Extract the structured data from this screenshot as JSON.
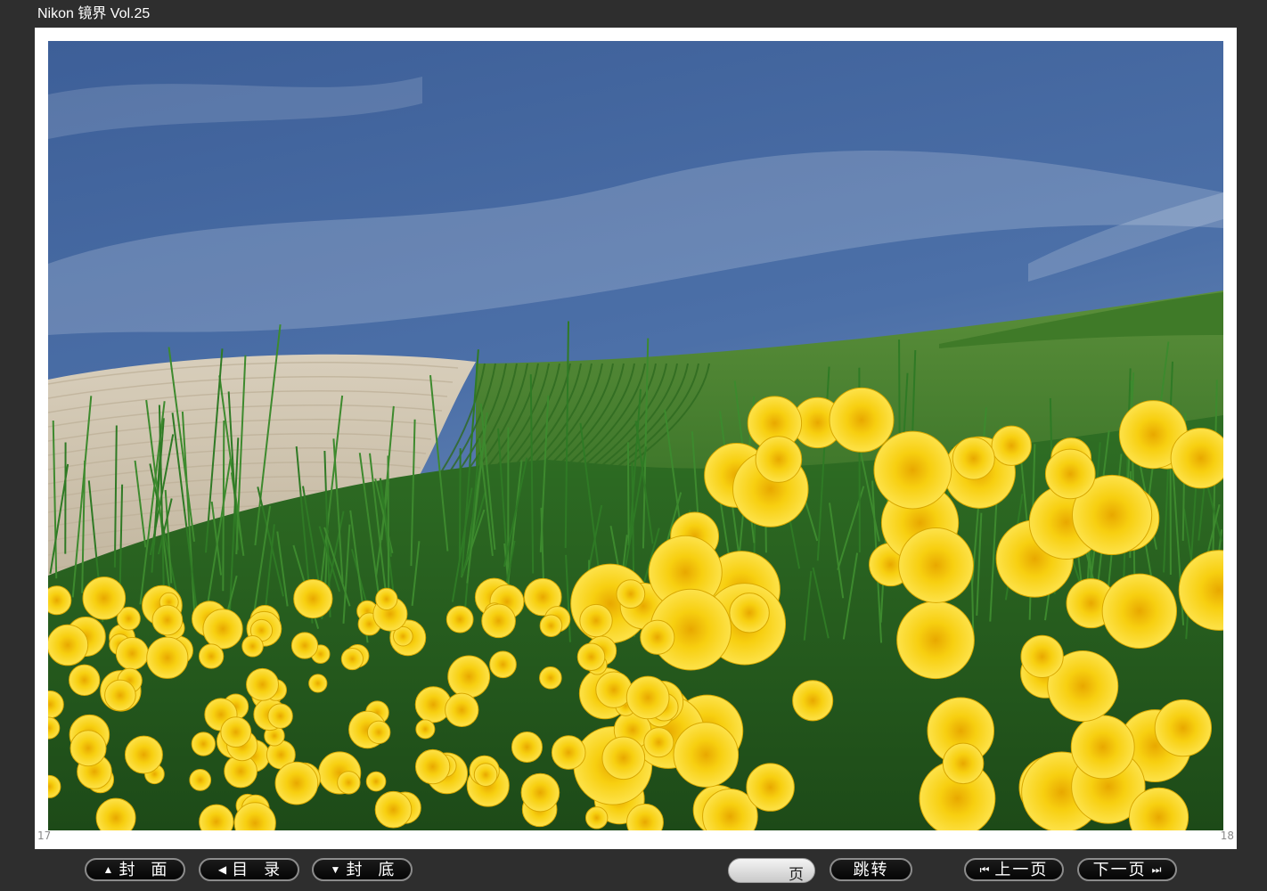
{
  "app": {
    "title": "Nikon 镜界 Vol.25"
  },
  "pages": {
    "left_number": "17",
    "right_number": "18"
  },
  "toolbar": {
    "cover": {
      "icon": "▲",
      "label": "封面"
    },
    "contents": {
      "icon": "◀",
      "label": "目录"
    },
    "back_cover": {
      "icon": "▼",
      "label": "封底"
    },
    "page_input": {
      "value": "",
      "unit": "页"
    },
    "jump": {
      "label": "跳转"
    },
    "prev": {
      "icon": "⏮",
      "label": "上一页"
    },
    "next": {
      "icon": "⏭",
      "label": "下一页"
    }
  },
  "colors": {
    "background": "#2e2e2e",
    "sky": "#3a5e96",
    "grass": "#3f7d2a",
    "field": "#cfc4b0",
    "flower": "#f5c800"
  }
}
